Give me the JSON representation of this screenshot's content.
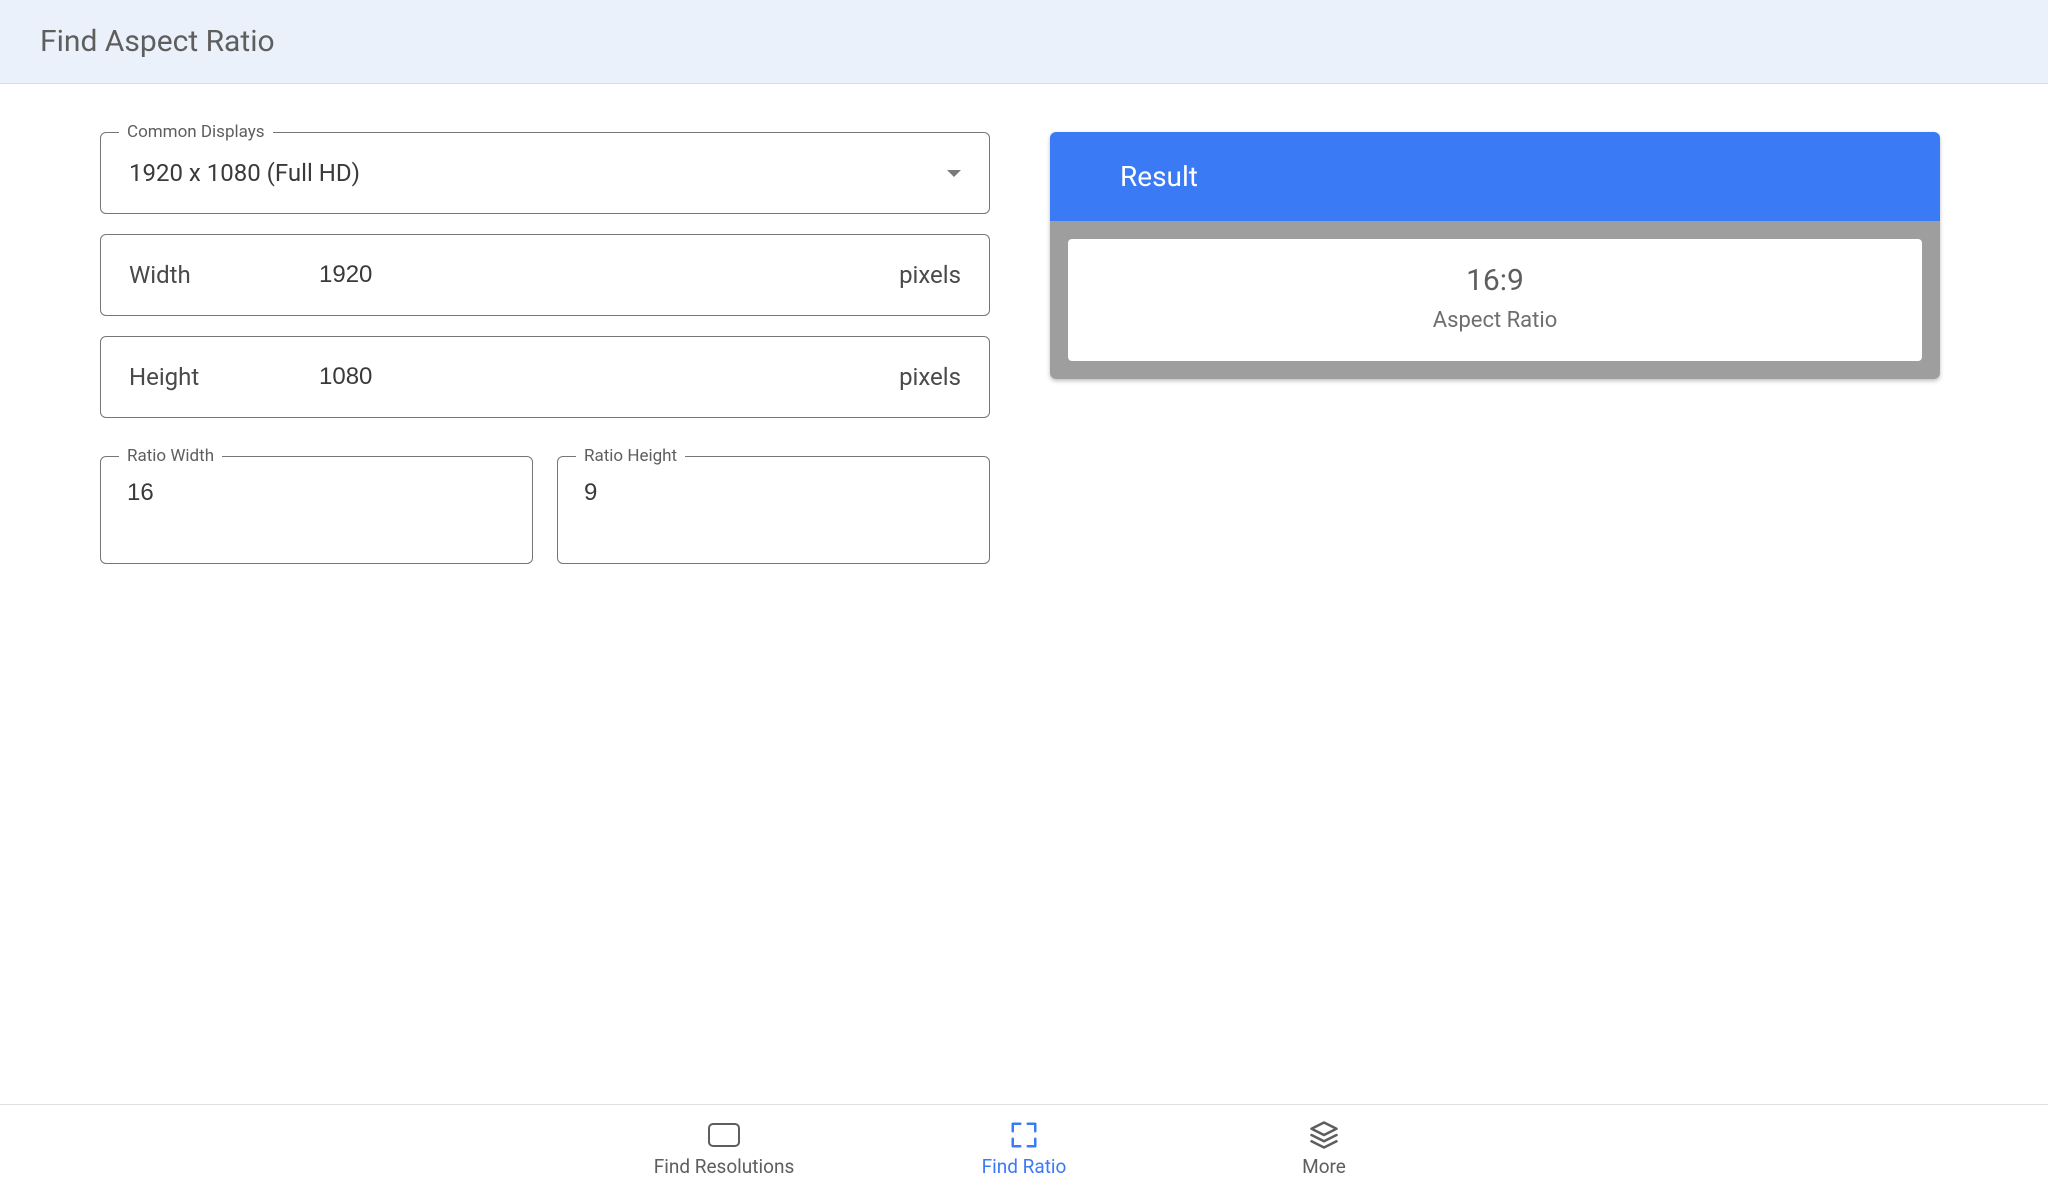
{
  "header": {
    "title": "Find Aspect Ratio"
  },
  "form": {
    "common_displays": {
      "label": "Common Displays",
      "selected": "1920 x 1080 (Full HD)"
    },
    "width": {
      "label": "Width",
      "value": "1920",
      "unit": "pixels"
    },
    "height": {
      "label": "Height",
      "value": "1080",
      "unit": "pixels"
    },
    "ratio_width": {
      "label": "Ratio Width",
      "value": "16"
    },
    "ratio_height": {
      "label": "Ratio Height",
      "value": "9"
    }
  },
  "result": {
    "header": "Result",
    "value": "16:9",
    "label": "Aspect Ratio"
  },
  "nav": {
    "find_resolutions": "Find Resolutions",
    "find_ratio": "Find Ratio",
    "more": "More"
  }
}
